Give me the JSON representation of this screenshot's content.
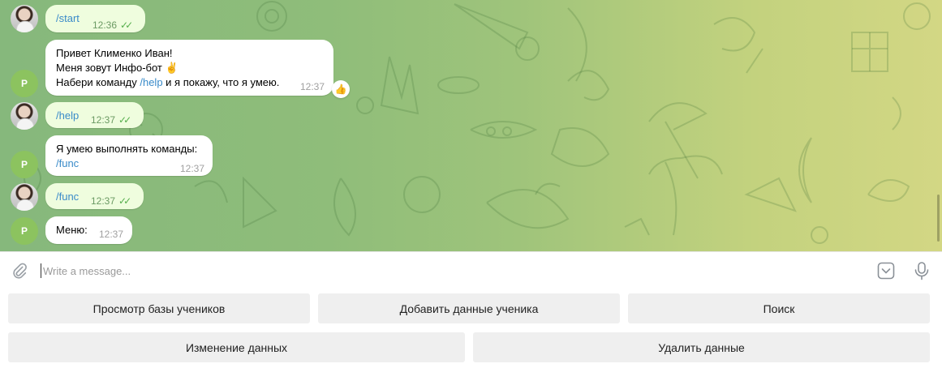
{
  "messages": [
    {
      "id": "m1",
      "direction": "out",
      "avatar": "user-avatar",
      "text": "/start",
      "time": "12:36",
      "status": "read"
    },
    {
      "id": "m2",
      "direction": "in",
      "avatar_letter": "P",
      "lines": [
        "Привет Клименко Иван!",
        "Меня зовут Инфо-бот ✌️"
      ],
      "line3_prefix": "Набери команду ",
      "line3_cmd": "/help",
      "line3_suffix": " и я покажу, что я умею.",
      "time": "12:37",
      "reaction": "👍"
    },
    {
      "id": "m3",
      "direction": "out",
      "text": "/help",
      "time": "12:37",
      "status": "read"
    },
    {
      "id": "m4",
      "direction": "in",
      "avatar_letter": "P",
      "line1": "Я умею выполнять команды:",
      "line2_cmd": "/func",
      "time": "12:37"
    },
    {
      "id": "m5",
      "direction": "out",
      "text": "/func",
      "time": "12:37",
      "status": "read"
    },
    {
      "id": "m6",
      "direction": "in",
      "avatar_letter": "P",
      "text": "Меню:",
      "time": "12:37"
    }
  ],
  "composer": {
    "placeholder": "Write a message...",
    "value": ""
  },
  "icons": {
    "attach": "paperclip-icon",
    "keyboard": "keyboard-toggle-icon",
    "mic": "microphone-icon",
    "read": "double-check-icon"
  },
  "keyboard": {
    "row1": [
      "Просмотр базы учеников",
      "Добавить данные ученика",
      "Поиск"
    ],
    "row2": [
      "Изменение данных",
      "Удалить данные"
    ]
  },
  "colors": {
    "outgoing_bubble": "#effdde",
    "incoming_bubble": "#ffffff",
    "link": "#3a8bc9",
    "read_checks": "#56ae4d",
    "bot_avatar": "#8cc35f"
  }
}
